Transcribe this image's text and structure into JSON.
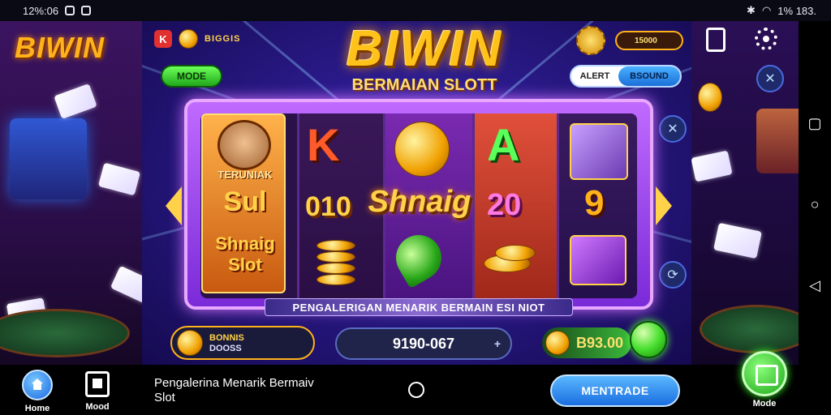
{
  "status_bar": {
    "time": "12%:06",
    "right_text": "1% 183."
  },
  "brand": {
    "left_logo": "BIWIN"
  },
  "header": {
    "top_label": "BIGGIS",
    "mode_button": "MODE",
    "coin_label": "15000",
    "logo_title": "BIWIN",
    "logo_subtitle": "BERMAIAN SLOTT",
    "toggle_left": "ALERT",
    "toggle_right": "BSOUND"
  },
  "reels": {
    "feature": {
      "line1": "TERUNIAK",
      "line2": "Sul",
      "line3": "Shnaig Slot"
    },
    "letters": [
      "K",
      "A"
    ],
    "payline_left": "010",
    "payline_center": "Shnaig",
    "payline_right": "20",
    "right_digit": "9"
  },
  "banner": "PENGALERIGAN MENARIK BERMAIN ESI NIOT",
  "controls": {
    "bonus_line1": "BONNIS",
    "bonus_line2": "DOOSS",
    "bet_value": "9190-067",
    "bet_plus": "+",
    "balance": "B93.00"
  },
  "bottom_nav": {
    "home_label": "Home",
    "mode_label": "Mood",
    "caption": "Pengalerina Menarik Bermaiv Slot",
    "action_button": "MENTRADE",
    "menu_label": "Mode"
  },
  "colors": {
    "gold": "#ffc21a",
    "green": "#3ab83a",
    "blue": "#1a6ee0",
    "purple": "#7a2ad8"
  }
}
